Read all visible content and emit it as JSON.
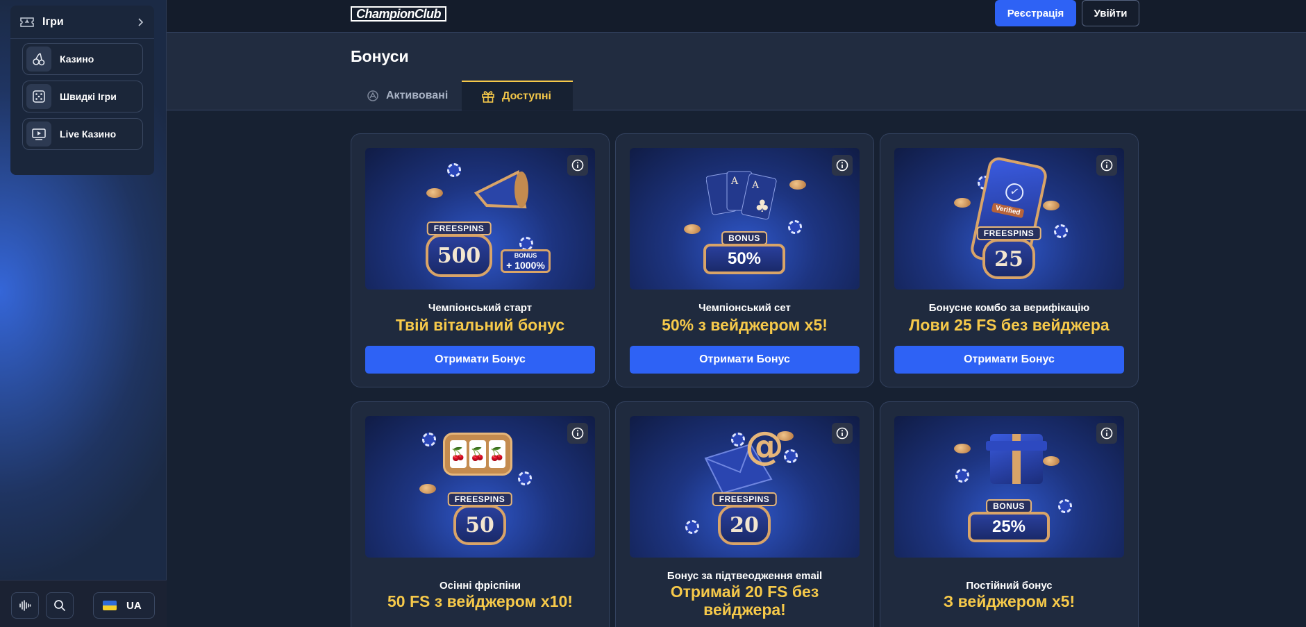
{
  "sidebar": {
    "games_label": "Ігри",
    "items": [
      {
        "label": "Казино",
        "icon": "cherries-icon"
      },
      {
        "label": "Швидкі Ігри",
        "icon": "dice-icon"
      },
      {
        "label": "Live Казино",
        "icon": "play-icon"
      }
    ],
    "language": "UA"
  },
  "header": {
    "logo_text": "ChampionClub",
    "register_label": "Реєстрація",
    "login_label": "Увійти"
  },
  "page": {
    "title": "Бонуси",
    "tabs": [
      {
        "label": "Активовані",
        "active": false
      },
      {
        "label": "Доступні",
        "active": true
      }
    ]
  },
  "cards": [
    {
      "subtitle": "Чемпіонський старт",
      "title": "Твій вітальний бонус",
      "button": "Отримати Бонус",
      "art": {
        "plate": "FREESPINS",
        "digits": "500",
        "extra_small": "BONUS",
        "extra": "+ 1000%"
      }
    },
    {
      "subtitle": "Чемпіонський сет",
      "title": "50% з вейджером х5!",
      "button": "Отримати Бонус",
      "art": {
        "plate": "BONUS",
        "value": "50%"
      }
    },
    {
      "subtitle": "Бонусне комбо за верифікацію",
      "title": "Лови 25 FS без вейджера",
      "button": "Отримати Бонус",
      "art": {
        "plate": "FREESPINS",
        "digits": "25",
        "badge": "Verified"
      }
    },
    {
      "subtitle": "Осінні фріспіни",
      "title": "50 FS з вейджером х10!",
      "art": {
        "plate": "FREESPINS",
        "digits": "50"
      }
    },
    {
      "subtitle": "Бонус за підтвеодження email",
      "title_line1": "Отримай 20 FS без",
      "title_line2": "вейджера!",
      "art": {
        "plate": "FREESPINS",
        "digits": "20",
        "symbol": "@"
      }
    },
    {
      "subtitle": "Постійний бонус",
      "title": "З вейджером х5!",
      "art": {
        "plate": "BONUS",
        "value": "25%"
      }
    }
  ],
  "colors": {
    "accent_blue": "#2e62f5",
    "accent_gold": "#f6c94a",
    "background": "#172132",
    "card": "#1f2a3e"
  }
}
